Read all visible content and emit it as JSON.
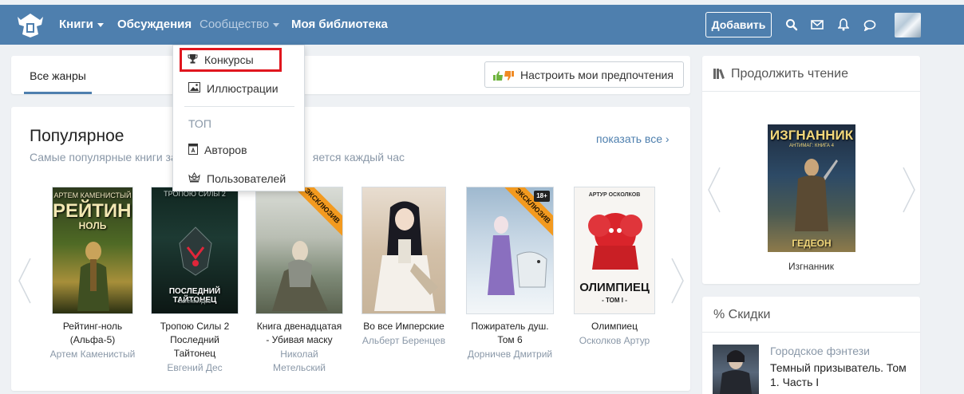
{
  "nav": {
    "items": [
      {
        "label": "Книги",
        "has_caret": true
      },
      {
        "label": "Обсуждения",
        "has_caret": false
      },
      {
        "label": "Сообщество",
        "has_caret": true
      },
      {
        "label": "Моя библиотека",
        "has_caret": false
      }
    ],
    "add_label": "Добавить",
    "icons": [
      "search-icon",
      "mail-icon",
      "bell-icon",
      "chat-icon"
    ],
    "brand_color": "#4e7fae"
  },
  "dropdown": {
    "items": [
      {
        "label": "Конкурсы",
        "icon": "trophy-icon",
        "highlighted": true
      },
      {
        "label": "Иллюстрации",
        "icon": "image-icon"
      }
    ],
    "section_heading": "ТОП",
    "top_items": [
      {
        "label": "Авторов",
        "icon": "author-book-icon"
      },
      {
        "label": "Пользователей",
        "icon": "crown-icon"
      }
    ],
    "highlight_color": "#e0161e"
  },
  "genres": {
    "active_tab": "Все жанры",
    "pref_label": "Настроить мои предпочтения"
  },
  "popular": {
    "title": "Популярное",
    "subtitle_left": "Самые популярные книги за",
    "subtitle_right": "яется каждый час",
    "show_all": "показать все",
    "books": [
      {
        "title": "Рейтинг-ноль (Альфа-5)",
        "author": "Артем Каменистый",
        "cover_author": "АРТЕМ КАМЕНИСТЫЙ",
        "cover_title": "РЕЙТИНГ",
        "cover_sub": "НОЛЬ",
        "exclusive": false
      },
      {
        "title": "Тропою Силы 2 Последний Тайтонец",
        "author": "Евгений Дес",
        "cover_author": "ТРОПОЮ СИЛЫ 2",
        "cover_title": "ПОСЛЕДНИЙ ТАЙТОНЕЦ",
        "cover_sub": "Евгений Дес",
        "exclusive": false
      },
      {
        "title": "Книга двенадцатая - Убивая маску",
        "author": "Николай Метельский",
        "cover_author": "",
        "cover_title": "",
        "cover_sub": "",
        "exclusive": true
      },
      {
        "title": "Во все Имперские",
        "author": "Альберт Беренцев",
        "cover_author": "",
        "cover_title": "",
        "cover_sub": "",
        "exclusive": false
      },
      {
        "title": "Пожиратель душ. Том 6",
        "author": "Дорничев Дмитрий",
        "cover_author": "",
        "cover_title": "",
        "cover_sub": "",
        "exclusive": true,
        "age": "18+"
      },
      {
        "title": "Олимпиец",
        "author": "Осколков Артур",
        "cover_author": "АРТУР ОСКОЛКОВ",
        "cover_title": "ОЛИМПИЕЦ",
        "cover_sub": "- ТОМ I -",
        "exclusive": false
      }
    ],
    "exclusive_label": "ЭКСКЛЮЗИВ"
  },
  "continue_reading": {
    "title": "Продолжить чтение",
    "book_title": "Изгнанник",
    "cover_title": "ИЗГНАННИК",
    "cover_series": "АНТИМАГ: КНИГА 4",
    "cover_author": "ГЕДЕОН"
  },
  "discounts": {
    "title": "% Скидки",
    "genre": "Городское фэнтези",
    "book_title": "Темный призыватель. Том 1. Часть I"
  }
}
